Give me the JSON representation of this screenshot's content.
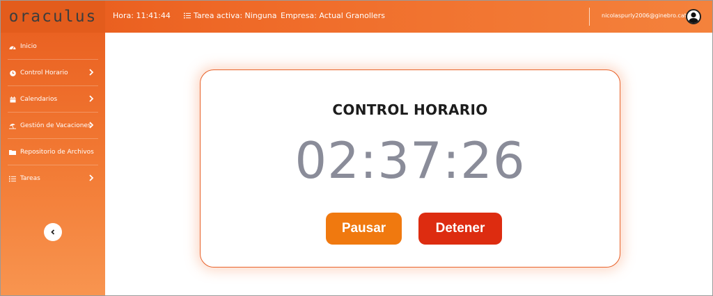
{
  "app": {
    "logo": "oraculus"
  },
  "topbar": {
    "time_label": "Hora: 11:41:44",
    "active_task": "Tarea activa: Ninguna",
    "company": "Empresa: Actual Granollers",
    "user_email": "nicolaspurly2006@ginebro.cat"
  },
  "sidebar": {
    "items": [
      {
        "label": "Inicio",
        "icon": "dashboard-icon",
        "has_submenu": false
      },
      {
        "label": "Control Horario",
        "icon": "clock-icon",
        "has_submenu": true
      },
      {
        "label": "Calendarios",
        "icon": "calendar-icon",
        "has_submenu": true
      },
      {
        "label": "Gestión de Vacaciones",
        "icon": "umbrella-beach-icon",
        "has_submenu": true
      },
      {
        "label": "Repositorio de Archivos",
        "icon": "folder-icon",
        "has_submenu": false
      },
      {
        "label": "Tareas",
        "icon": "list-icon",
        "has_submenu": true
      }
    ]
  },
  "main": {
    "title": "CONTROL HORARIO",
    "timer": "02:37:26",
    "pause_label": "Pausar",
    "stop_label": "Detener"
  },
  "colors": {
    "accent": "#ef6a28",
    "pause_button": "#f0790f",
    "stop_button": "#dd2c10",
    "timer_text": "#8a8c99"
  }
}
